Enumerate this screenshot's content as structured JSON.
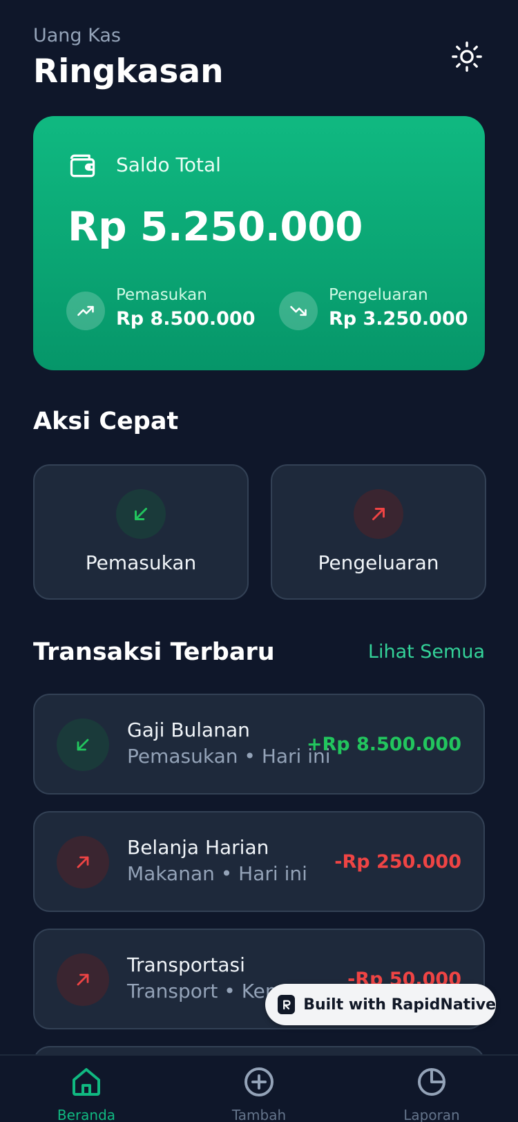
{
  "header": {
    "subtitle": "Uang Kas",
    "title": "Ringkasan",
    "theme_icon": "sun-icon"
  },
  "balance": {
    "label": "Saldo Total",
    "value": "Rp 5.250.000",
    "income_label": "Pemasukan",
    "income_value": "Rp 8.500.000",
    "expense_label": "Pengeluaran",
    "expense_value": "Rp 3.250.000"
  },
  "quick_actions": {
    "title": "Aksi Cepat",
    "income_label": "Pemasukan",
    "expense_label": "Pengeluaran"
  },
  "recent": {
    "title": "Transaksi Terbaru",
    "see_all": "Lihat Semua",
    "items": [
      {
        "name": "Gaji Bulanan",
        "meta": "Pemasukan • Hari ini",
        "amount": "+Rp 8.500.000",
        "type": "in"
      },
      {
        "name": "Belanja Harian",
        "meta": "Makanan • Hari ini",
        "amount": "-Rp 250.000",
        "type": "out"
      },
      {
        "name": "Transportasi",
        "meta": "Transport • Kem",
        "amount": "-Rp 50.000",
        "type": "out"
      }
    ]
  },
  "badge": {
    "text": "Built with RapidNative"
  },
  "nav": {
    "home": "Beranda",
    "add": "Tambah",
    "report": "Laporan"
  },
  "colors": {
    "accent": "#10b981",
    "background": "#0f172a",
    "card": "#1e293b",
    "income": "#22c55e",
    "expense": "#ef4444"
  }
}
